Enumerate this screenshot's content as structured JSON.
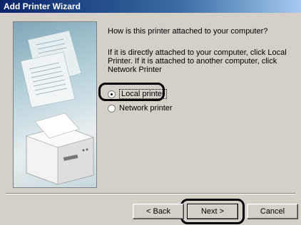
{
  "window": {
    "title": "Add Printer Wizard"
  },
  "side_image": {
    "icon": "printer-illustration-icon"
  },
  "content": {
    "question": "How is this printer attached to your computer?",
    "explanation": "If it is directly attached to your computer, click Local Printer. If it is attached to another computer, click Network Printer",
    "options": [
      {
        "label": "Local printer",
        "checked": true
      },
      {
        "label": "Network printer",
        "checked": false
      }
    ]
  },
  "buttons": {
    "back": "< Back",
    "next": "Next >",
    "cancel": "Cancel"
  }
}
